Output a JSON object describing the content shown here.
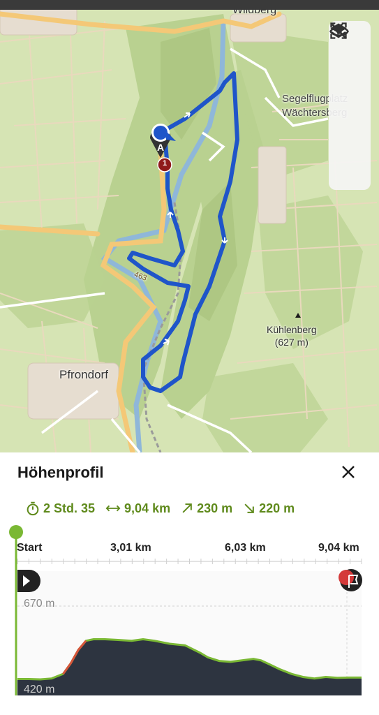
{
  "map": {
    "places": {
      "wildberg": "Wildberg",
      "segel_line1": "Segelflugplatz",
      "segel_line2": "Wächtersberg",
      "kuehlenberg_name": "Kühlenberg",
      "kuehlenberg_elev": "(627 m)",
      "pfrondorf": "Pfrondorf",
      "road_number": "463"
    },
    "markers": {
      "start_letter": "A",
      "waypoint_number": "1"
    },
    "controls": [
      "navigate-icon",
      "layers-icon",
      "focus-icon",
      "hide-icon"
    ],
    "colors": {
      "route": "#1f55c9",
      "terrain": "#d6e4b4",
      "forest": "#b9d190",
      "road_major": "#f4c877",
      "water": "#8fb7d9"
    }
  },
  "sheet": {
    "title": "Höhenprofil",
    "stats": {
      "duration": "2 Std. 35",
      "distance": "9,04 km",
      "ascent": "230 m",
      "descent": "220 m"
    },
    "colors": {
      "accent": "#5f8a1c",
      "profile_fill": "#2d3440",
      "profile_line": "#7ab834"
    }
  },
  "chart_data": {
    "type": "area",
    "title": "Höhenprofil",
    "x_tick_labels": [
      "Start",
      "3,01 km",
      "6,03 km",
      "9,04 km"
    ],
    "y_tick_labels": [
      "670 m",
      "420 m"
    ],
    "xlim": [
      0,
      9.04
    ],
    "ylim": [
      420,
      670
    ],
    "x": [
      0,
      0.3,
      0.6,
      0.9,
      1.2,
      1.4,
      1.6,
      1.8,
      2.0,
      2.3,
      2.6,
      3.0,
      3.3,
      3.6,
      4.0,
      4.4,
      4.8,
      5.0,
      5.3,
      5.6,
      5.9,
      6.2,
      6.4,
      6.6,
      6.9,
      7.2,
      7.5,
      7.8,
      8.1,
      8.4,
      8.7,
      9.04
    ],
    "y": [
      428,
      428,
      427,
      430,
      445,
      480,
      525,
      555,
      560,
      560,
      558,
      555,
      560,
      555,
      545,
      540,
      515,
      500,
      488,
      485,
      490,
      495,
      490,
      478,
      460,
      445,
      435,
      430,
      435,
      432,
      433,
      433
    ]
  }
}
